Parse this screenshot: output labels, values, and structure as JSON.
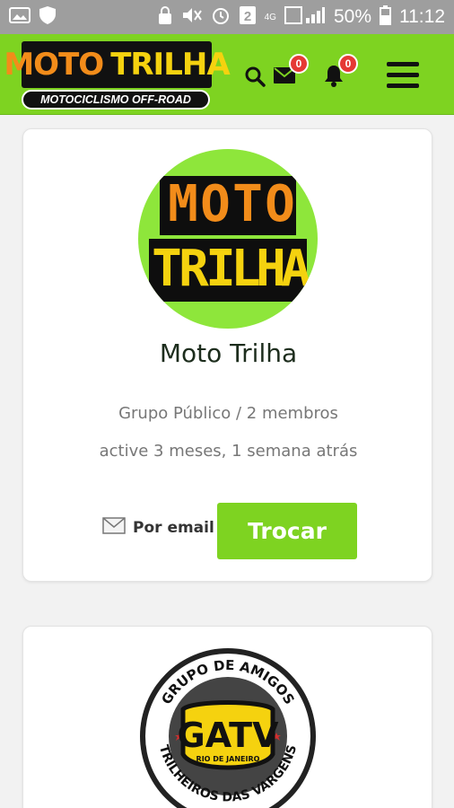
{
  "status_bar": {
    "signal_label": "4G",
    "sim_number": "2",
    "battery": "50%",
    "time": "11:12"
  },
  "header": {
    "logo_word1": "MOTO",
    "logo_word2": "TRILHA",
    "logo_subtitle": "MOTOCICLISMO OFF-ROAD",
    "messages_badge": "0",
    "notifications_badge": "0",
    "icons": [
      "search-icon",
      "envelope-icon",
      "bell-icon",
      "hamburger-menu-icon"
    ],
    "colors": {
      "brand_green": "#7ed321",
      "badge_red": "#e53935"
    }
  },
  "groups": [
    {
      "avatar_word1": "MOTO",
      "avatar_word2": "TRILHA",
      "name": "Moto Trilha",
      "type": "Grupo Público / 2 membros",
      "activity": "active 3 meses, 1 semana atrás",
      "email_label": "Por email",
      "action_label": "Trocar"
    },
    {
      "avatar_top_text": "GRUPO DE AMIGOS",
      "avatar_center_text": "GATV",
      "avatar_center_sub": "RIO DE JANEIRO",
      "avatar_bottom_text": "TRILHEIROS DAS VARGENS"
    }
  ]
}
